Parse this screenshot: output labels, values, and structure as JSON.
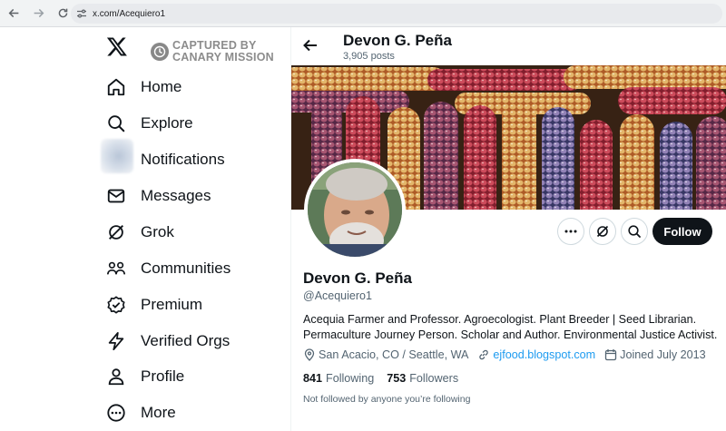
{
  "browser": {
    "url": "x.com/Acequiero1"
  },
  "watermark": {
    "line1": "CAPTURED BY",
    "line2": "CANARY MISSION"
  },
  "nav": {
    "items": [
      {
        "label": "Home",
        "icon": "home-icon"
      },
      {
        "label": "Explore",
        "icon": "search-icon"
      },
      {
        "label": "Notifications",
        "icon": "bell-icon"
      },
      {
        "label": "Messages",
        "icon": "mail-icon"
      },
      {
        "label": "Grok",
        "icon": "grok-icon"
      },
      {
        "label": "Communities",
        "icon": "communities-icon"
      },
      {
        "label": "Premium",
        "icon": "premium-icon"
      },
      {
        "label": "Verified Orgs",
        "icon": "lightning-icon"
      },
      {
        "label": "Profile",
        "icon": "person-icon"
      },
      {
        "label": "More",
        "icon": "more-circle-icon"
      }
    ]
  },
  "header": {
    "name": "Devon G. Peña",
    "posts": "3,905 posts"
  },
  "profile": {
    "name": "Devon G. Peña",
    "handle": "@Acequiero1",
    "bio_line1": "Acequia Farmer and Professor. Agroecologist. Plant Breeder | Seed Librarian.",
    "bio_line2": "Permaculture Journey Person. Scholar and Author. Environmental Justice Activist.",
    "location": "San Acacio, CO /  Seattle, WA",
    "website": "ejfood.blogspot.com",
    "joined": "Joined July 2013",
    "following_count": "841",
    "following_label": "Following",
    "followers_count": "753",
    "followers_label": "Followers",
    "not_followed": "Not followed by anyone you’re following"
  },
  "actions": {
    "follow_label": "Follow"
  },
  "colors": {
    "accent": "#1d9bf0",
    "follow_bg": "#0f1419"
  }
}
